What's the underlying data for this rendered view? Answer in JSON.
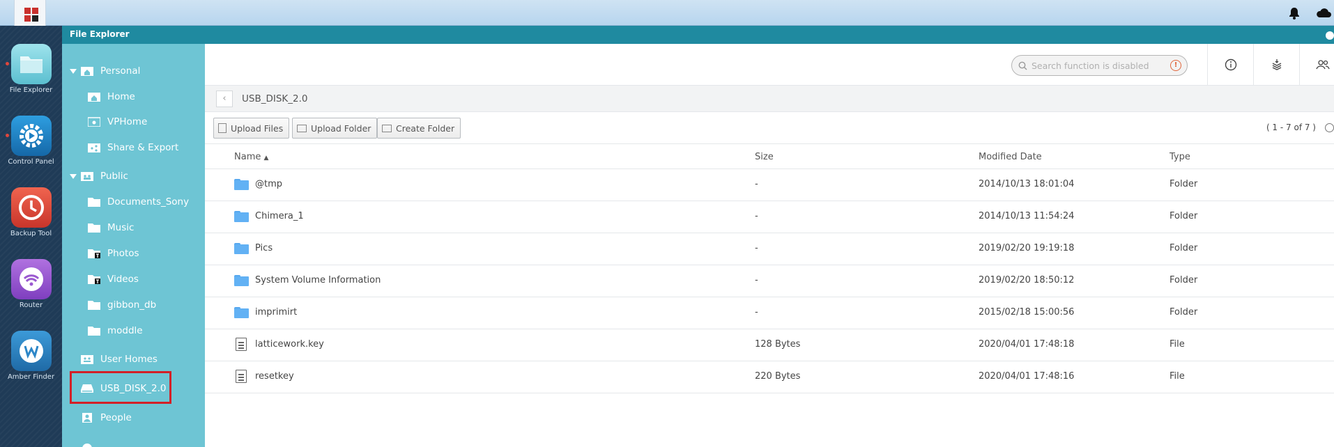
{
  "window": {
    "title": "File Explorer"
  },
  "dock": [
    {
      "name": "dock-file-explorer",
      "label": "File Explorer",
      "color": "#7fd3e0",
      "icon": "folder-icon",
      "running": true
    },
    {
      "name": "dock-control-panel",
      "label": "Control Panel",
      "color": "#1d7fc4",
      "icon": "gear-icon",
      "running": true
    },
    {
      "name": "dock-backup-tool",
      "label": "Backup Tool",
      "color": "#e84c3d",
      "icon": "clock-icon",
      "running": false
    },
    {
      "name": "dock-router",
      "label": "Router",
      "color": "#9b59d0",
      "icon": "wifi-icon",
      "running": false
    },
    {
      "name": "dock-amber-finder",
      "label": "Amber Finder",
      "color": "#2b86c8",
      "icon": "amber-finder-icon",
      "running": false
    }
  ],
  "sidebar": {
    "personal": "Personal",
    "home": "Home",
    "vphome": "VPHome",
    "share_export": "Share & Export",
    "public": "Public",
    "documents_sony": "Documents_Sony",
    "music": "Music",
    "photos": "Photos",
    "videos": "Videos",
    "gibbon_db": "gibbon_db",
    "moddle": "moddle",
    "user_homes": "User Homes",
    "usb_disk": "USB_DISK_2.0",
    "people": "People"
  },
  "search": {
    "placeholder": "Search function is disabled"
  },
  "path": {
    "current": "USB_DISK_2.0"
  },
  "actions": {
    "upload_files": "Upload Files",
    "upload_folder": "Upload Folder",
    "create_folder": "Create Folder",
    "count": "( 1 - 7 of 7 )"
  },
  "table": {
    "headers": {
      "name": "Name",
      "size": "Size",
      "modified": "Modified Date",
      "type": "Type"
    },
    "rows": [
      {
        "name": "@tmp",
        "size": "-",
        "modified": "2014/10/13 18:01:04",
        "type": "Folder"
      },
      {
        "name": "Chimera_1",
        "size": "-",
        "modified": "2014/10/13 11:54:24",
        "type": "Folder"
      },
      {
        "name": "Pics",
        "size": "-",
        "modified": "2019/02/20 19:19:18",
        "type": "Folder"
      },
      {
        "name": "System Volume Information",
        "size": "-",
        "modified": "2019/02/20 18:50:12",
        "type": "Folder"
      },
      {
        "name": "imprimirt",
        "size": "-",
        "modified": "2015/02/18 15:00:56",
        "type": "Folder"
      },
      {
        "name": "latticework.key",
        "size": "128 Bytes",
        "modified": "2020/04/01 17:48:18",
        "type": "File"
      },
      {
        "name": "resetkey",
        "size": "220 Bytes",
        "modified": "2020/04/01 17:48:16",
        "type": "File"
      }
    ]
  }
}
